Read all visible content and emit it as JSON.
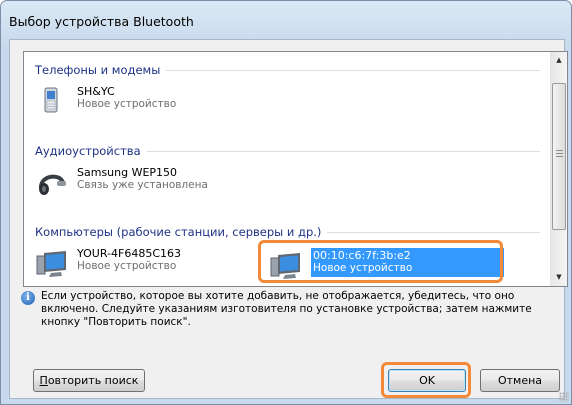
{
  "window": {
    "title": "Выбор устройства Bluetooth"
  },
  "groups": [
    {
      "label": "Телефоны и модемы",
      "devices": [
        {
          "name": "SH&YC",
          "status": "Новое устройство",
          "icon": "phone-icon"
        }
      ]
    },
    {
      "label": "Аудиоустройства",
      "devices": [
        {
          "name": "Samsung WEP150",
          "status": "Связь уже установлена",
          "icon": "headset-icon"
        }
      ]
    },
    {
      "label": "Компьютеры (рабочие станции, серверы и др.)",
      "devices": [
        {
          "name": "YOUR-4F6485C163",
          "status": "Новое устройство",
          "icon": "computer-icon"
        },
        {
          "name": "00:10:c6:7f:3b:e2",
          "status": "Новое устройство",
          "icon": "computer-icon",
          "selected": true
        }
      ]
    }
  ],
  "info": {
    "icon": "info-icon",
    "text": "Если устройство, которое вы хотите добавить, не отображается, убедитесь, что оно включено. Следуйте указаниям изготовителя по установке устройства; затем нажмите кнопку \"Повторить поиск\"."
  },
  "buttons": {
    "retry_mnemonic": "П",
    "retry_rest": "овторить поиск",
    "ok": "OK",
    "cancel": "Отмена"
  },
  "colors": {
    "accent_selection": "#3399ff",
    "highlight_frame": "#f28a3a",
    "group_header_text": "#1e3287"
  }
}
